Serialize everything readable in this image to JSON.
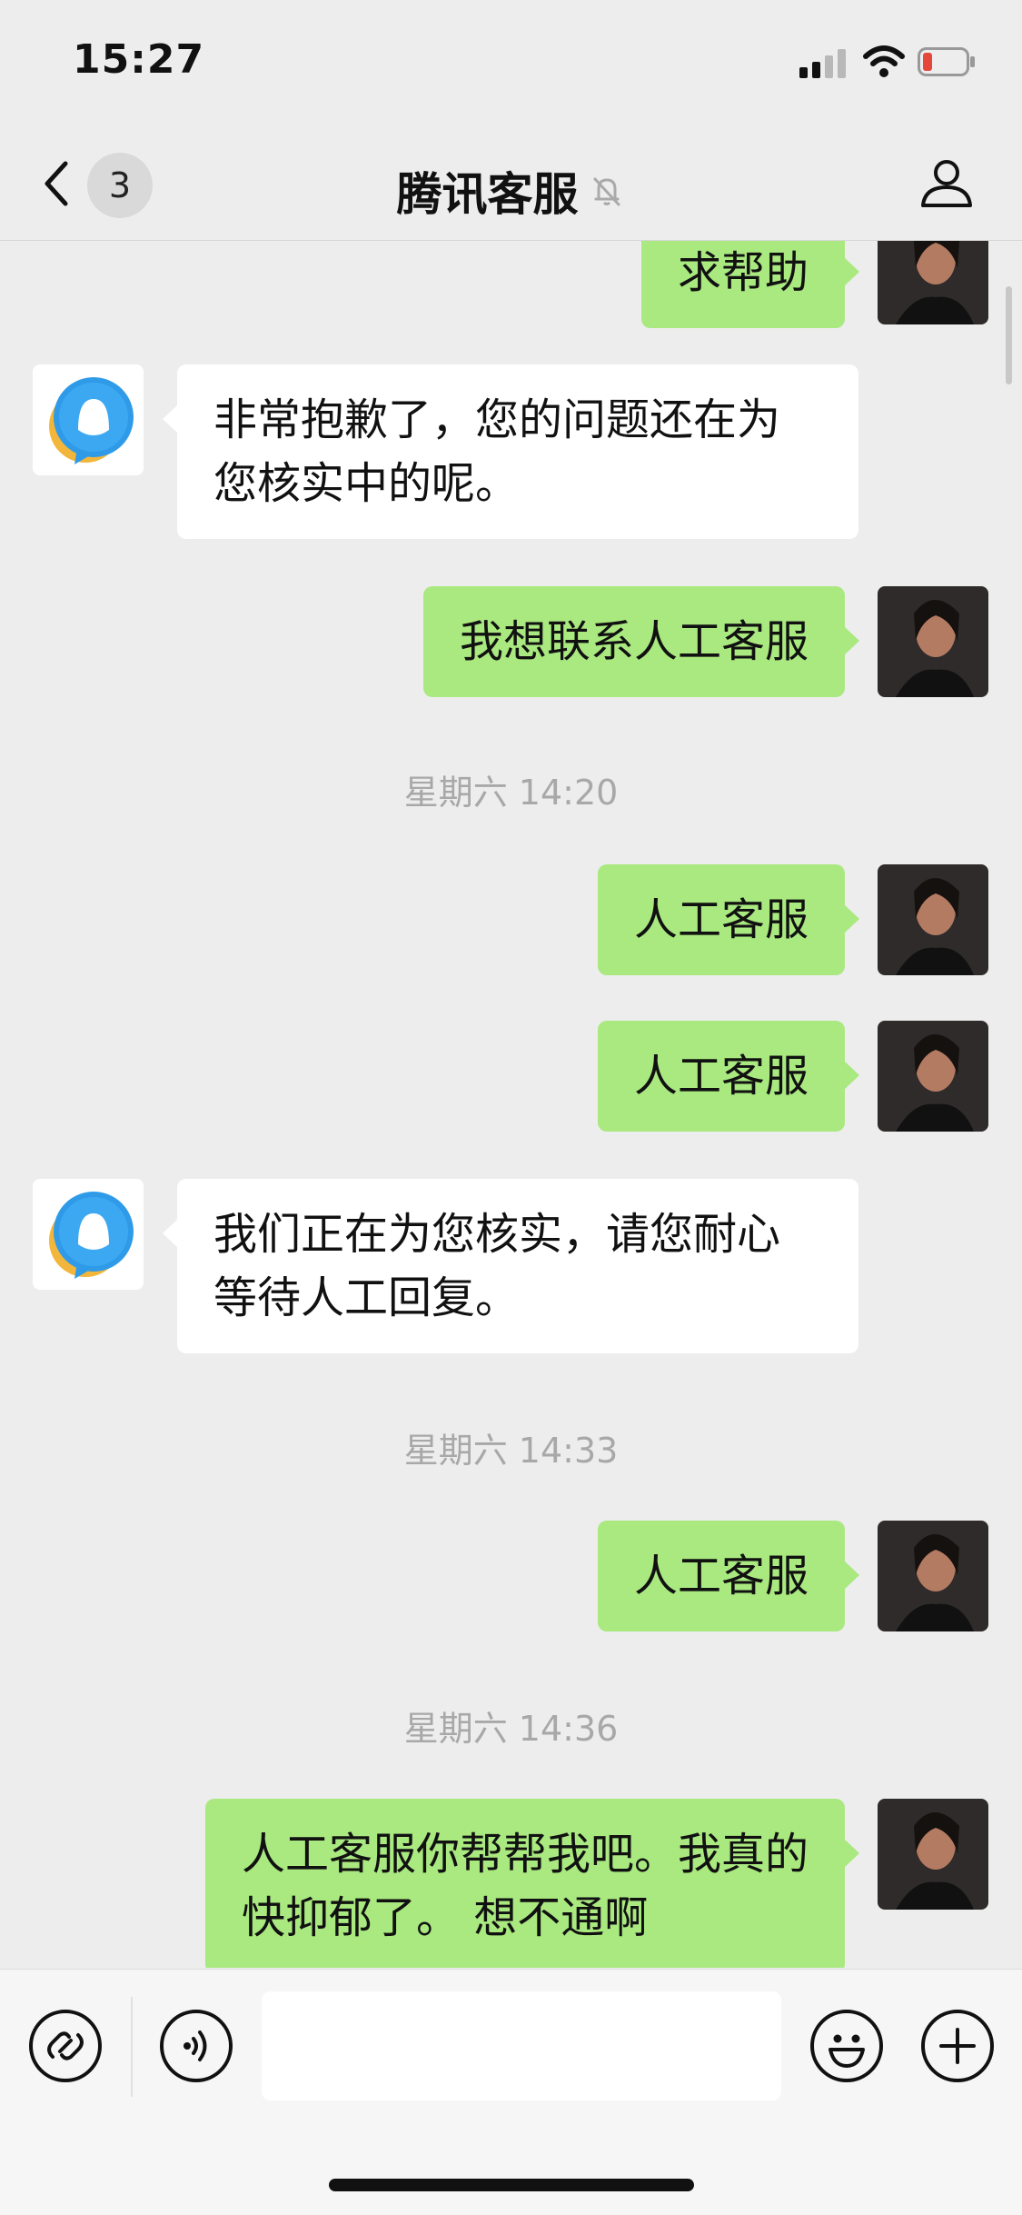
{
  "status_bar": {
    "time": "15:27",
    "battery_level": 0.1,
    "signal_bars": 2
  },
  "nav": {
    "unread_count": "3",
    "title": "腾讯客服"
  },
  "chat": {
    "messages": [
      {
        "sender": "me",
        "text": "求帮助"
      },
      {
        "sender": "cs",
        "text": "非常抱歉了，您的问题还在为\n您核实中的呢。"
      },
      {
        "sender": "me",
        "text": "我想联系人工客服"
      },
      {
        "sender": "me",
        "text": "人工客服"
      },
      {
        "sender": "me",
        "text": "人工客服"
      },
      {
        "sender": "cs",
        "text": "我们正在为您核实，请您耐心\n等待人工回复。"
      },
      {
        "sender": "me",
        "text": "人工客服"
      },
      {
        "sender": "me",
        "text": "人工客服你帮帮我吧。我真的\n快抑郁了。 想不通啊"
      }
    ],
    "timestamps": [
      "星期六 14:20",
      "星期六 14:33",
      "星期六 14:36"
    ]
  },
  "input": {
    "value": "",
    "placeholder": ""
  },
  "icons": {
    "back": "chevron-left-icon",
    "mute": "bell-off-icon",
    "profile": "person-icon",
    "mini": "link-icon",
    "voice": "voice-icon",
    "emoji": "smiley-icon",
    "plus": "plus-icon"
  },
  "colors": {
    "my_bubble": "#a9e980",
    "their_bubble": "#ffffff",
    "background": "#ededed",
    "battery_low": "#e5473b"
  }
}
